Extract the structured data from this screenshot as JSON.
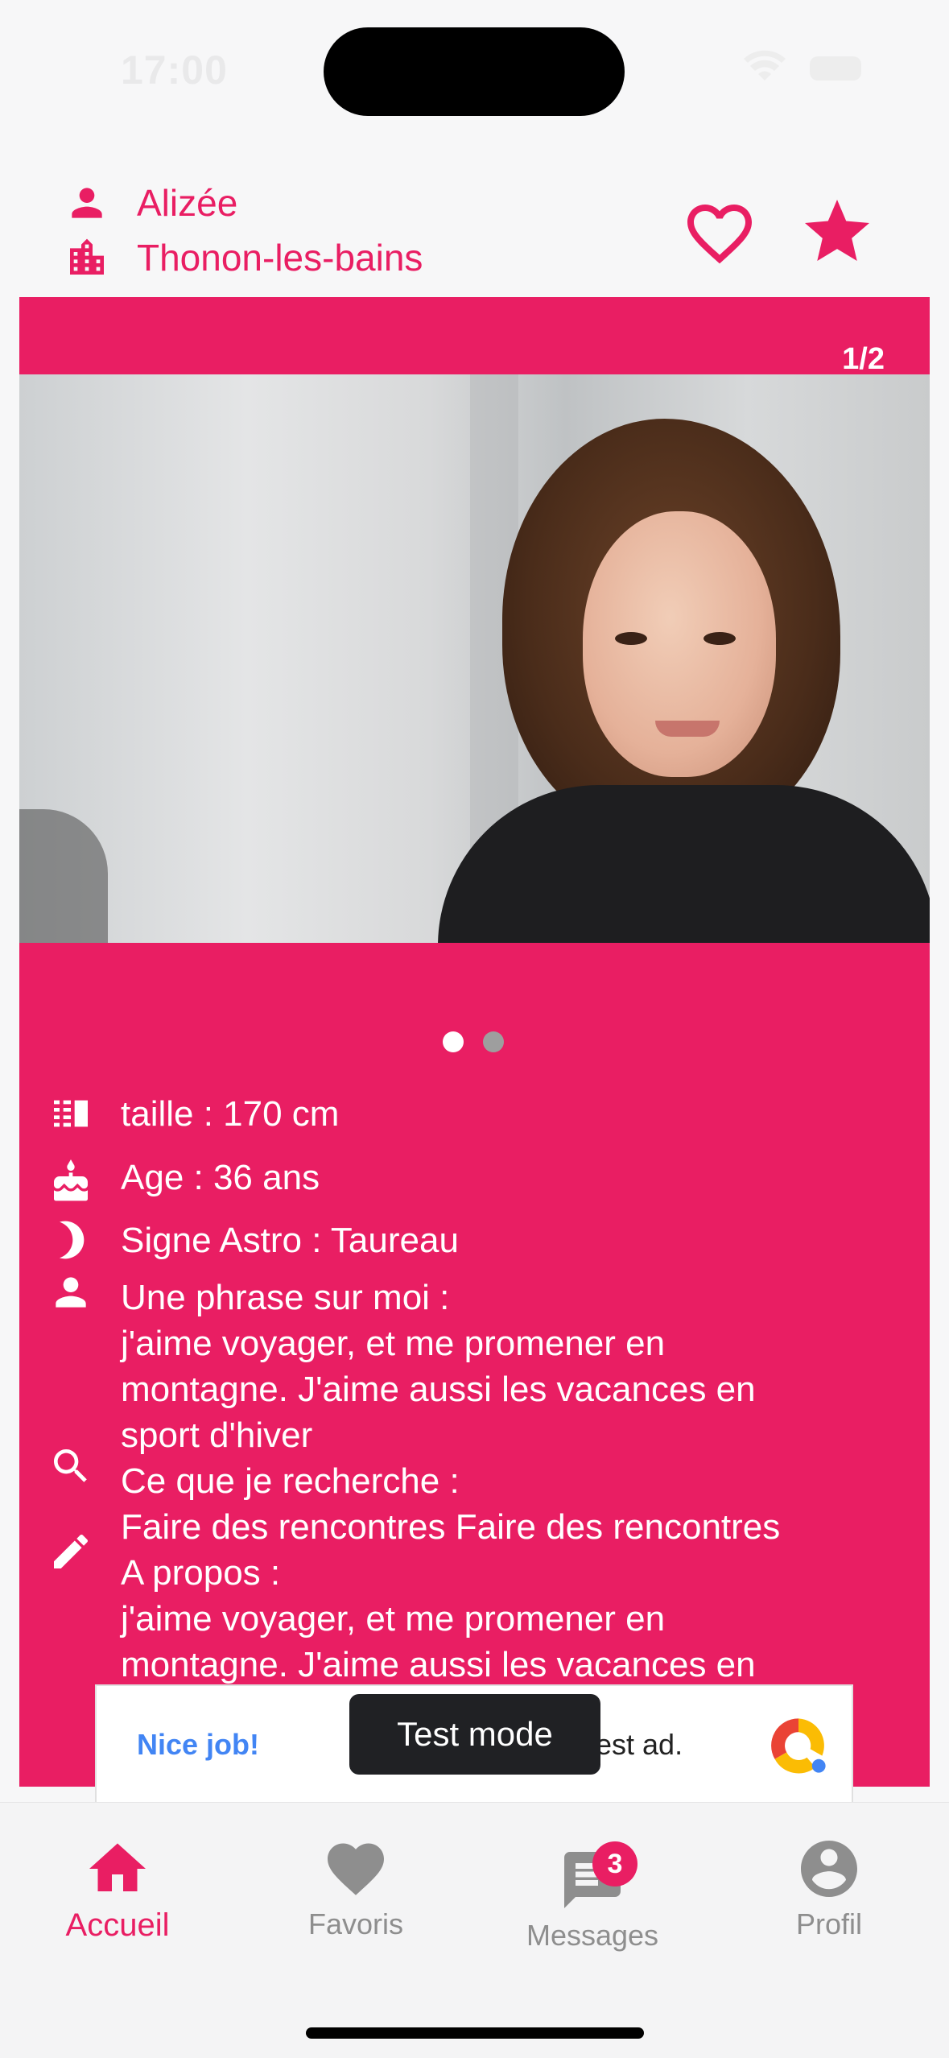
{
  "status_bar": {
    "time": "17:00"
  },
  "header": {
    "name": "Alizée",
    "city": "Thonon-les-bains"
  },
  "card": {
    "photo_counter": "1/2",
    "carousel": {
      "total": 2,
      "active_index": 1
    },
    "info": {
      "height": "taille : 170 cm",
      "age": "Age : 36 ans",
      "astro": "Signe Astro : Taureau",
      "about_me": "Une phrase sur moi :\nj'aime voyager, et me promener en\nmontagne. J'aime aussi les vacances en\nsport d'hiver",
      "looking_for": "Ce que je recherche :\nFaire des rencontres Faire des rencontres",
      "a_propos": "A propos :\nj'aime voyager, et me promener en\nmontagne. J'aime aussi les vacances en"
    }
  },
  "ad": {
    "left_text": "Nice job!",
    "right_text": "est ad.",
    "toast": "Test mode"
  },
  "bottom_nav": {
    "items": [
      {
        "label": "Accueil",
        "icon": "home-icon",
        "active": true
      },
      {
        "label": "Favoris",
        "icon": "heart-icon",
        "active": false
      },
      {
        "label": "Messages",
        "icon": "chat-icon",
        "active": false,
        "badge": "3"
      },
      {
        "label": "Profil",
        "icon": "account-circle-icon",
        "active": false
      }
    ]
  },
  "colors": {
    "accent": "#e91e63",
    "inactive": "#8e8e8e",
    "background": "#f7f7f8"
  }
}
